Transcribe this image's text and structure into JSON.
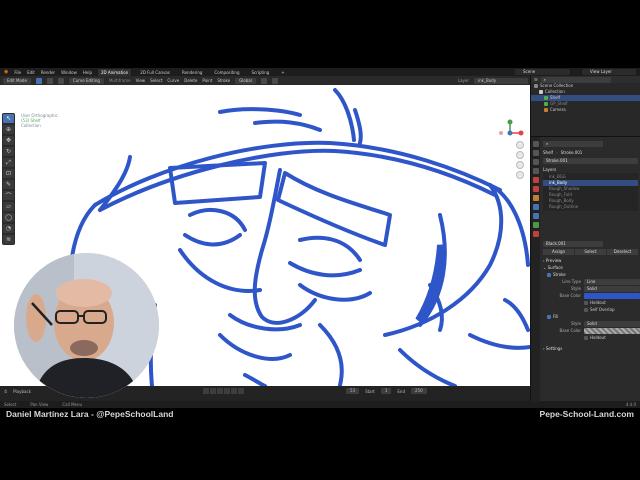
{
  "topbar": {
    "menus": [
      "File",
      "Edit",
      "Render",
      "Window",
      "Help"
    ],
    "workspaces": [
      "2D Animation",
      "2D Full Canvas",
      "Rendering",
      "Compositing",
      "Scripting",
      "+"
    ],
    "active_workspace": "2D Animation",
    "scene": "Scene",
    "view_layer": "View Layer"
  },
  "header": {
    "mode": "Edit Mode",
    "curve_editing": "Curve Editing",
    "multiframe": "Multiframe",
    "menus": [
      "View",
      "Select",
      "Curve",
      "Delete",
      "Point",
      "Stroke"
    ],
    "orientation": "Global",
    "layer_field": "Layer",
    "layer_value": "ink_Body"
  },
  "viewport": {
    "info_line1": "User Orthographic",
    "info_line2": "(53) Shelf",
    "info_line3": "Collection"
  },
  "outliner": {
    "title": "Scene Collection",
    "items": [
      "Collection",
      "Shelf",
      "GP_Shelf",
      "Camera"
    ]
  },
  "properties": {
    "object_name": "Shelf",
    "data_name": "Stroke.001",
    "gp_data": "Stroke.001",
    "layers_title": "Layers",
    "layers": [
      "ink_BGG",
      "ink_Body",
      "Rough_Shadow",
      "Rough_Fold",
      "Rough_Body",
      "Rough_Outline"
    ],
    "selected_layer": "ink_Body",
    "material": "Black.001",
    "buttons": [
      "Assign",
      "Select",
      "Deselect"
    ],
    "sections": [
      "Preview",
      "Surface",
      "Stroke"
    ],
    "line_type_label": "Line Type",
    "line_type": "Line",
    "style_label": "Style",
    "style": "Solid",
    "base_color_label": "Base Color",
    "holdout": "Holdout",
    "self_overlap": "Self Overlap",
    "fill": "Fill",
    "fill_style": "Solid",
    "fill_base_color_label": "Base Color",
    "settings": "Settings"
  },
  "timeline": {
    "playback": "Playback",
    "current_frame": "53",
    "start_label": "Start",
    "start": "1",
    "end_label": "End",
    "end": "250"
  },
  "statusbar": {
    "items": [
      "Select",
      "Pan View",
      "Call Menu"
    ],
    "version": "4.4.0"
  },
  "captions": {
    "left": "Daniel Martínez Lara - @PepeSchoolLand",
    "right": "Pepe-School-Land.com"
  },
  "colors": {
    "stroke_blue": "#2f56c8",
    "accent": "#4772b3",
    "viewport_bg": "#ffffff",
    "panel_bg": "#2b2b2b"
  }
}
